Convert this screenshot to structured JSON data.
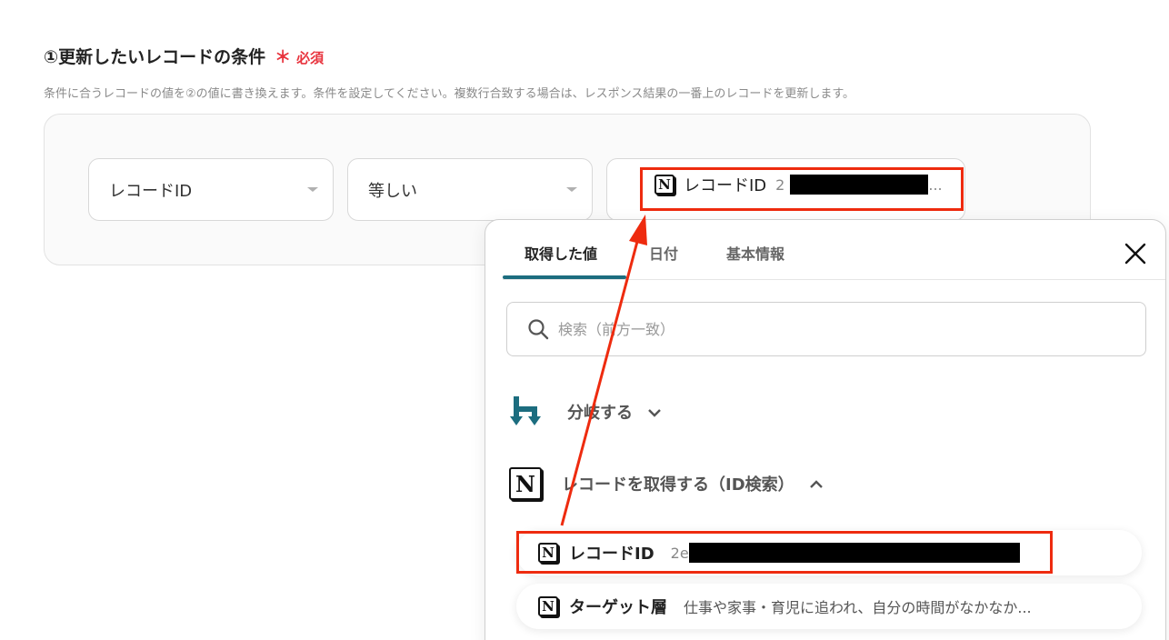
{
  "section": {
    "title": "①更新したいレコードの条件",
    "required_mark": "＊",
    "required_label": "必須",
    "description": "条件に合うレコードの値を②の値に書き換えます。条件を設定してください。複数行合致する場合は、レスポンス結果の一番上のレコードを更新します。"
  },
  "condition": {
    "field_select": "レコードID",
    "operator_select": "等しい",
    "value_label": "レコードID",
    "value_prefix": "2",
    "value_ellipsis": "..."
  },
  "panel": {
    "tabs": [
      {
        "label": "取得した値",
        "active": true
      },
      {
        "label": "日付",
        "active": false
      },
      {
        "label": "基本情報",
        "active": false
      }
    ],
    "search_placeholder": "検索（前方一致）",
    "groups": [
      {
        "label": "分岐する",
        "icon": "branch-icon",
        "expanded": false
      },
      {
        "label": "レコードを取得する（ID検索）",
        "icon": "notion-icon",
        "expanded": true
      }
    ],
    "items": [
      {
        "label": "レコードID",
        "value": "2e"
      },
      {
        "label": "ターゲット層",
        "value": "仕事や家事・育児に追われ、自分の時間がなかなか..."
      }
    ]
  },
  "colors": {
    "accent": "#1c6d7f",
    "highlight": "#ee2b0f",
    "required": "#e8343e"
  }
}
